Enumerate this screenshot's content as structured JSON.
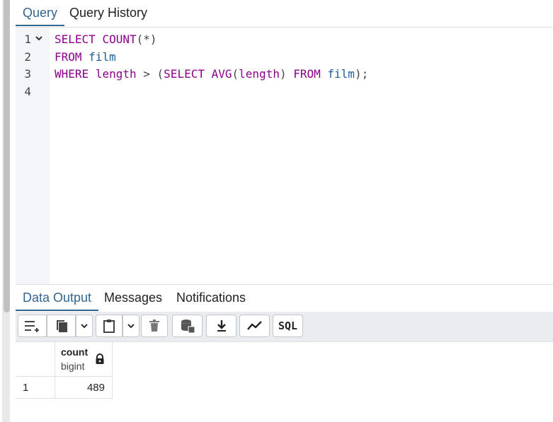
{
  "editor_tabs": [
    {
      "label": "Query",
      "active": true
    },
    {
      "label": "Query History",
      "active": false
    }
  ],
  "editor": {
    "line_numbers": [
      "1",
      "2",
      "3",
      "4"
    ],
    "lines": {
      "l1": {
        "select": "SELECT",
        "count": "COUNT",
        "paren_star": "(*)"
      },
      "l2": {
        "from": "FROM",
        "table": "film"
      },
      "l3": {
        "where": "WHERE",
        "col": "length",
        "op": ">",
        "lparen": "(",
        "select": "SELECT",
        "avg": "AVG",
        "avg_open": "(",
        "avg_arg": "length",
        "avg_close": ")",
        "from": "FROM",
        "table": "film",
        "end": ");"
      }
    }
  },
  "output_tabs": [
    {
      "label": "Data Output",
      "active": true
    },
    {
      "label": "Messages",
      "active": false
    },
    {
      "label": "Notifications",
      "active": false
    }
  ],
  "toolbar": {
    "sql_label": "SQL",
    "icons": [
      "add-row-icon",
      "copy-icon",
      "chevron-down-icon",
      "paste-icon",
      "chevron-down-icon",
      "delete-icon",
      "save-data-icon",
      "download-icon",
      "graph-icon",
      "sql-icon"
    ]
  },
  "result": {
    "column": {
      "name": "count",
      "type": "bigint"
    },
    "rows": [
      {
        "row_num": "1",
        "value": "489"
      }
    ]
  },
  "colors": {
    "accent": "#326690",
    "keyword": "#8b008b",
    "identifier": "#1f5c99"
  }
}
